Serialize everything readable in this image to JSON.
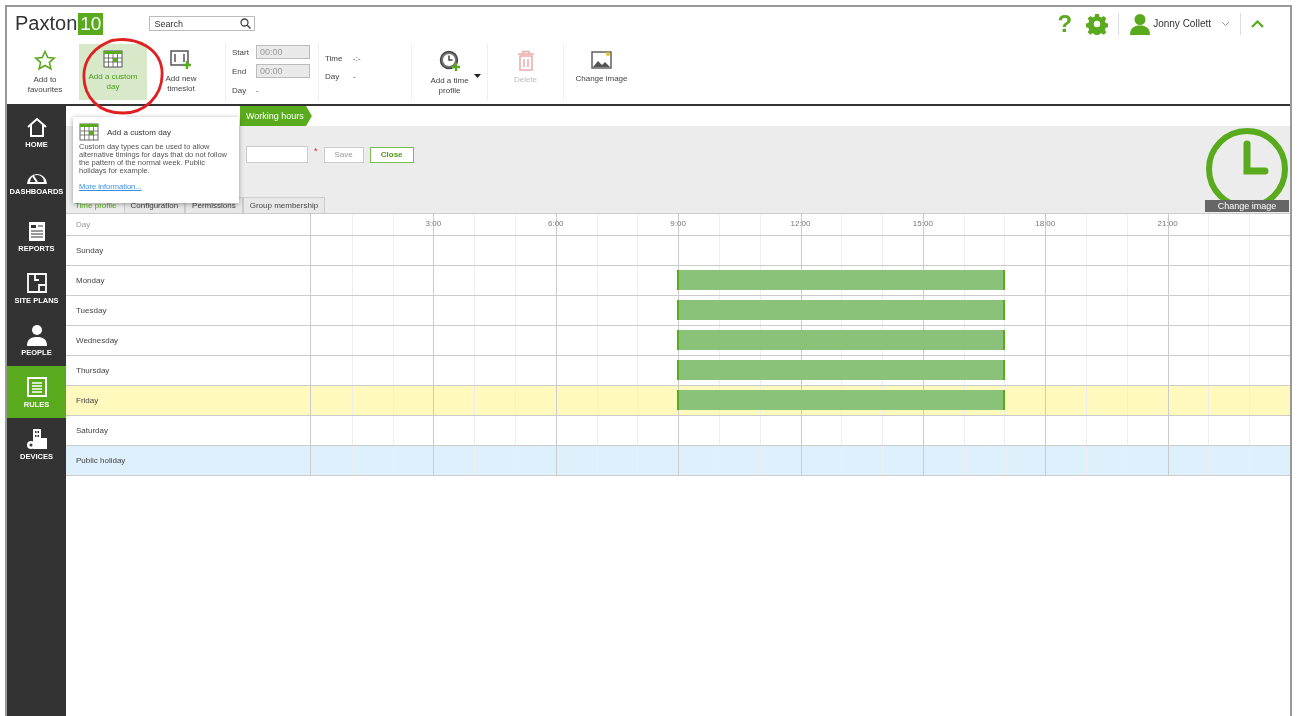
{
  "header": {
    "logo": "Paxton",
    "logo_badge": "10",
    "search": {
      "placeholder": "Search"
    },
    "help": "?",
    "user": "Jonny Collett"
  },
  "toolbar": {
    "buttons": [
      {
        "label": "Add to favourites",
        "kind": "star",
        "selected": false,
        "disabled": false
      },
      {
        "label": "Add a custom day",
        "kind": "calendar",
        "selected": true,
        "disabled": false
      },
      {
        "label": "Add new timeslot",
        "kind": "timeslot",
        "selected": false,
        "disabled": false
      }
    ],
    "fields": [
      {
        "label": "Start",
        "placeholder": "00:00"
      },
      {
        "label": "End",
        "placeholder": "00:00"
      }
    ],
    "day_label": "Day",
    "day_value": "-",
    "info": [
      {
        "label": "Time",
        "value": "-:-"
      },
      {
        "label": "Day",
        "value": "-"
      }
    ],
    "actions": [
      {
        "label": "Add a time profile",
        "kind": "clock",
        "dropdown": true,
        "disabled": false
      },
      {
        "label": "Delete",
        "kind": "trash",
        "dropdown": false,
        "disabled": true
      },
      {
        "label": "Change image",
        "kind": "image",
        "dropdown": false,
        "disabled": false
      }
    ]
  },
  "sidebar": {
    "items": [
      {
        "label": "HOME",
        "selected": false
      },
      {
        "label": "DASHBOARDS",
        "selected": false
      },
      {
        "label": "REPORTS",
        "selected": false
      },
      {
        "label": "SITE PLANS",
        "selected": false
      },
      {
        "label": "PEOPLE",
        "selected": false
      },
      {
        "label": "RULES",
        "selected": true
      },
      {
        "label": "DEVICES",
        "selected": false
      }
    ]
  },
  "breadcrumb": "Working hours",
  "form": {
    "required_mark": "*",
    "save": "Save",
    "close": "Close",
    "change_image": "Change image"
  },
  "tabs": [
    {
      "label": "Time profile",
      "selected": true
    },
    {
      "label": "Configuration",
      "selected": false
    },
    {
      "label": "Permissions",
      "selected": false
    },
    {
      "label": "Group membership",
      "selected": false
    }
  ],
  "grid": {
    "day_heading": "Day",
    "ticks": [
      "3:00",
      "6:00",
      "9:00",
      "12:00",
      "15:00",
      "18:00",
      "21:00"
    ],
    "rows": [
      {
        "day": "Sunday",
        "kind": "normal",
        "slots": []
      },
      {
        "day": "Monday",
        "kind": "normal",
        "slots": [
          {
            "start": {
              "level": 0.375
            },
            "end": {
              "level": 0.7083
            }
          }
        ]
      },
      {
        "day": "Tuesday",
        "kind": "normal",
        "slots": [
          {
            "start": {
              "level": 0.375
            },
            "end": {
              "level": 0.7083
            }
          }
        ]
      },
      {
        "day": "Wednesday",
        "kind": "normal",
        "slots": [
          {
            "start": {
              "level": 0.375
            },
            "end": {
              "level": 0.7083
            }
          }
        ]
      },
      {
        "day": "Thursday",
        "kind": "normal",
        "slots": [
          {
            "start": {
              "level": 0.375
            },
            "end": {
              "level": 0.7083
            }
          }
        ]
      },
      {
        "day": "Friday",
        "kind": "today",
        "slots": [
          {
            "start": {
              "level": 0.375
            },
            "end": {
              "level": 0.7083
            }
          }
        ]
      },
      {
        "day": "Saturday",
        "kind": "normal",
        "slots": []
      },
      {
        "day": "Public holiday",
        "kind": "holiday",
        "slots": []
      }
    ]
  },
  "tooltip": {
    "title": "Add a custom day",
    "text": "Custom day types can be used to allow alternative timings for days that do not follow the pattern of the normal week. Public holidays for example.",
    "link": "More information..."
  }
}
